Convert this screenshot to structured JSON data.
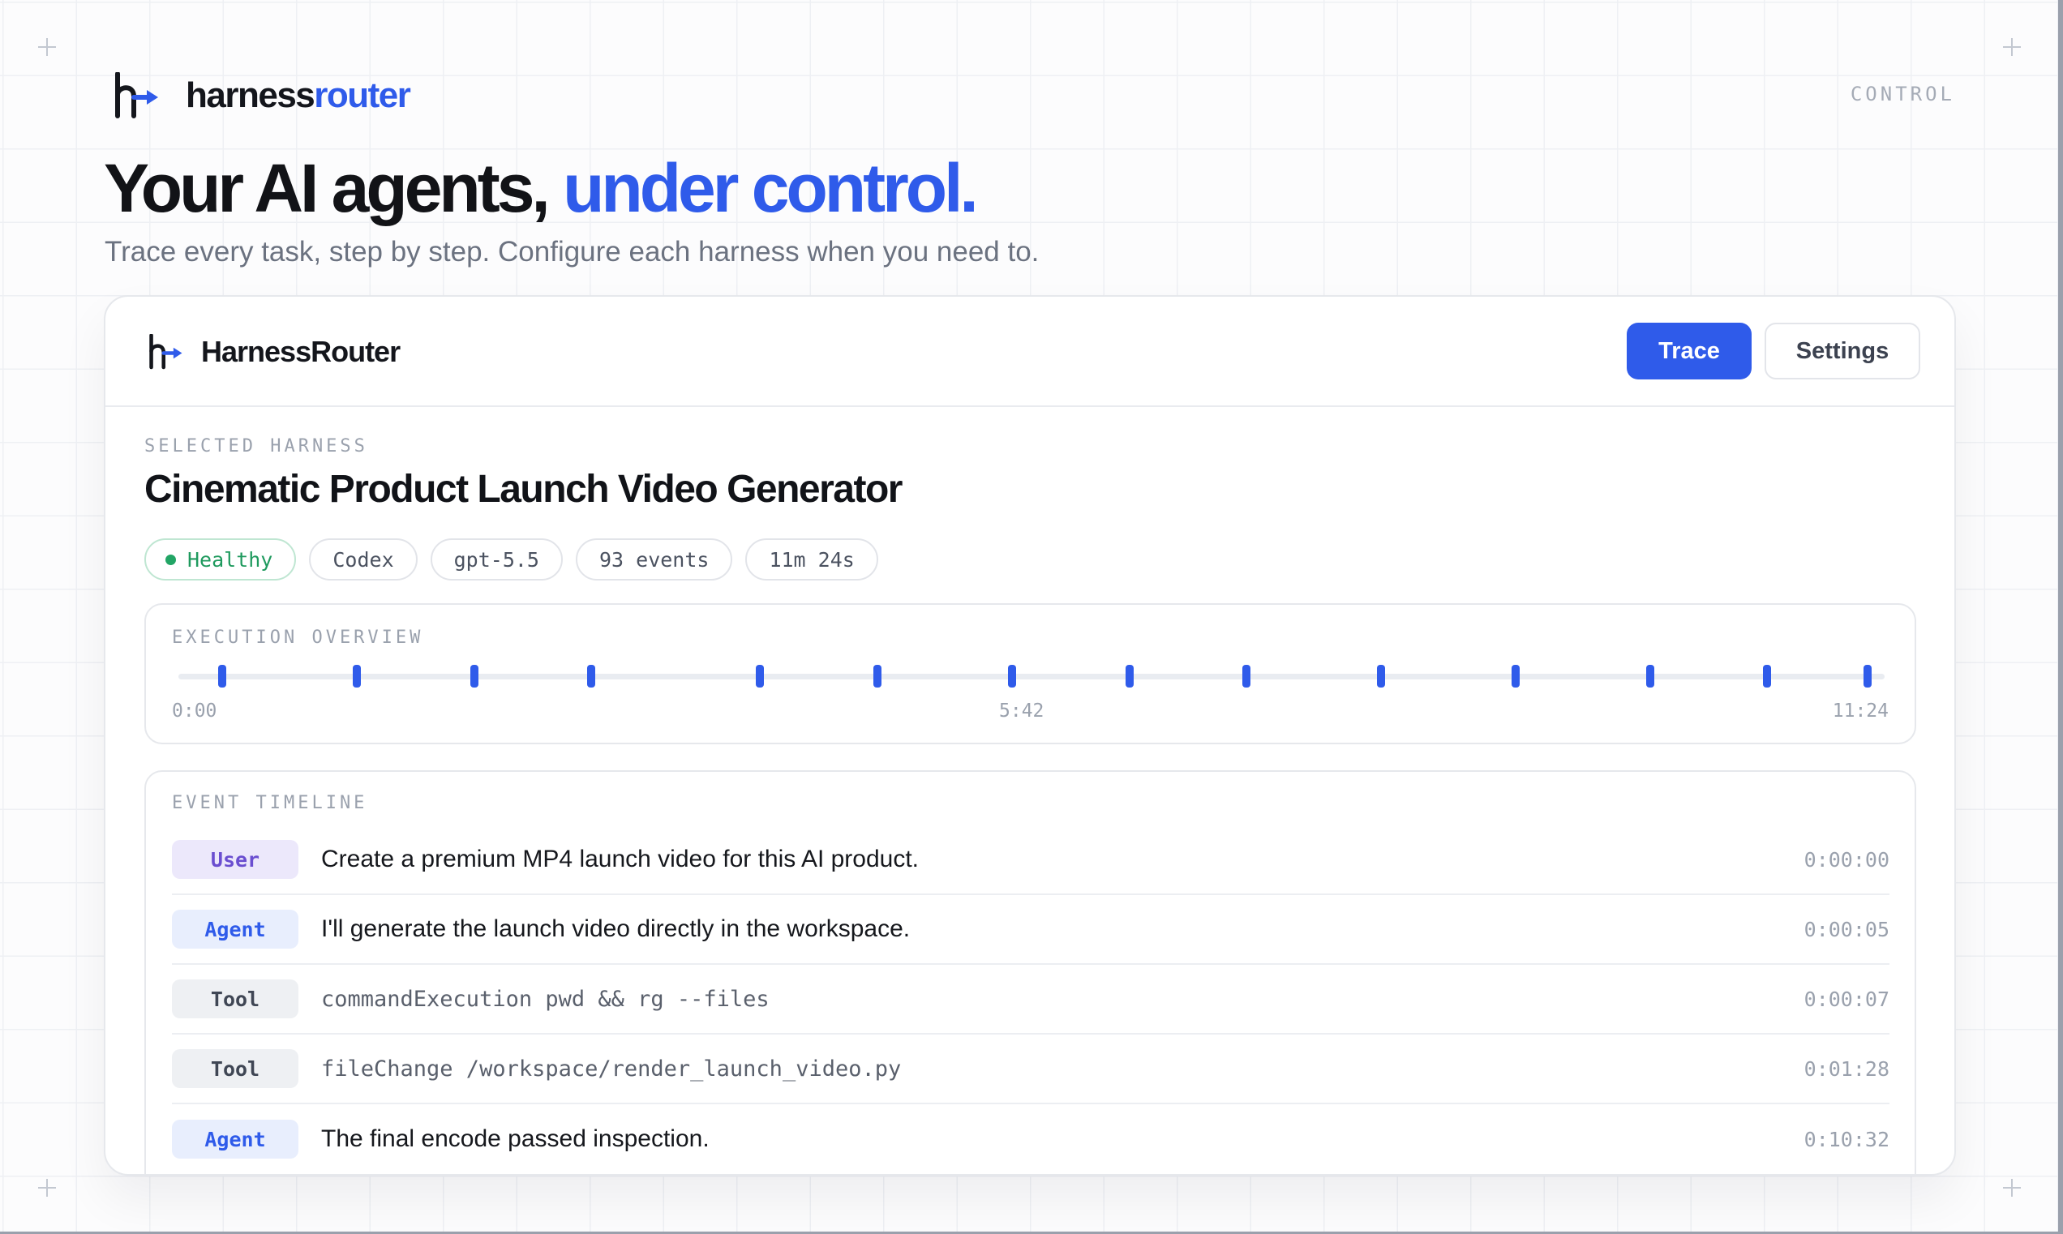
{
  "brand": {
    "name_prefix": "harness",
    "name_accent": "router"
  },
  "nav": {
    "control_label": "CONTROL"
  },
  "hero": {
    "title_main": "Your AI agents, ",
    "title_accent": "under control.",
    "subtitle": "Trace every task, step by step. Configure each harness when you need to."
  },
  "card": {
    "app_name": "HarnessRouter",
    "buttons": {
      "trace": "Trace",
      "settings": "Settings"
    },
    "active_tab": "Trace"
  },
  "harness": {
    "section_label": "SELECTED HARNESS",
    "title": "Cinematic Product Launch Video Generator",
    "status": "Healthy",
    "chips": [
      "Codex",
      "gpt-5.5",
      "93 events",
      "11m 24s"
    ]
  },
  "overview": {
    "label": "EXECUTION OVERVIEW",
    "axis_start": "0:00",
    "axis_mid": "5:42",
    "axis_end": "11:24",
    "duration_seconds": 684,
    "event_markers_seconds": [
      11,
      66,
      114,
      162,
      231,
      279,
      334,
      382,
      430,
      485,
      540,
      595,
      643,
      684
    ]
  },
  "timeline": {
    "label": "EVENT TIMELINE",
    "events": [
      {
        "role": "User",
        "kind": "user",
        "text": "Create a premium MP4 launch video for this AI product.",
        "mono": false,
        "time": "0:00:00"
      },
      {
        "role": "Agent",
        "kind": "agent",
        "text": "I'll generate the launch video directly in the workspace.",
        "mono": false,
        "time": "0:00:05"
      },
      {
        "role": "Tool",
        "kind": "tool",
        "text": "commandExecution pwd && rg --files",
        "mono": true,
        "time": "0:00:07"
      },
      {
        "role": "Tool",
        "kind": "tool",
        "text": "fileChange /workspace/render_launch_video.py",
        "mono": true,
        "time": "0:01:28"
      },
      {
        "role": "Agent",
        "kind": "agent",
        "text": "The final encode passed inspection.",
        "mono": false,
        "time": "0:10:32"
      }
    ]
  },
  "colors": {
    "accent": "#2f5bea",
    "healthy": "#22a565",
    "user_badge": "#6a4ed0",
    "agent_badge": "#2f5bea",
    "tool_badge": "#3f4654"
  },
  "icons": [
    "harnessrouter-logo-icon",
    "plus-corner-icon",
    "status-dot-icon"
  ]
}
